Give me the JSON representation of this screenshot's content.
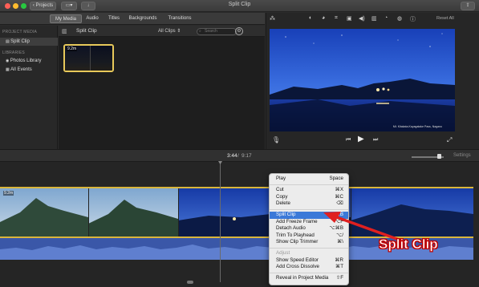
{
  "window": {
    "title": "Split Clip",
    "projects_label": "Projects"
  },
  "tabs": [
    {
      "label": "My Media"
    },
    {
      "label": "Audio"
    },
    {
      "label": "Titles"
    },
    {
      "label": "Backgrounds"
    },
    {
      "label": "Transitions"
    }
  ],
  "sidebar": {
    "project_media_header": "PROJECT MEDIA",
    "project_item": "Split Clip",
    "libraries_header": "LIBRARIES",
    "library_items": [
      "Photos Library",
      "All Events"
    ]
  },
  "browser": {
    "title": "Split Clip",
    "filter_value": "All Clips",
    "search_placeholder": "Search",
    "clip_duration": "9.2m"
  },
  "viewer": {
    "reset_all": "Reset All",
    "watermark": "Mt. Kitakata-Kayagatake Pass, Nagano"
  },
  "timeline": {
    "current_time": "3:44",
    "total_time": "9:17",
    "settings_label": "Settings",
    "clip_duration": "9.2m"
  },
  "context_menu": {
    "groups": [
      [
        {
          "label": "Play",
          "shortcut": "Space"
        }
      ],
      [
        {
          "label": "Cut",
          "shortcut": "⌘X"
        },
        {
          "label": "Copy",
          "shortcut": "⌘C"
        },
        {
          "label": "Delete",
          "shortcut": "⌫"
        }
      ],
      [
        {
          "label": "Split Clip",
          "shortcut": "⌘B",
          "highlighted": true
        },
        {
          "label": "Add Freeze Frame",
          "shortcut": "⌥F"
        },
        {
          "label": "Detach Audio",
          "shortcut": "⌥⌘B"
        },
        {
          "label": "Trim To Playhead",
          "shortcut": "⌥/"
        },
        {
          "label": "Show Clip Trimmer",
          "shortcut": "⌘\\"
        }
      ],
      [
        {
          "label": "Adjust",
          "shortcut": "",
          "disabled": true
        },
        {
          "label": "Show Speed Editor",
          "shortcut": "⌘R"
        },
        {
          "label": "Add Cross Dissolve",
          "shortcut": "⌘T"
        }
      ],
      [
        {
          "label": "Reveal in Project Media",
          "shortcut": "⇧F"
        }
      ]
    ]
  },
  "annotation": {
    "callout_text": "Split Clip"
  },
  "colors": {
    "accent_highlight": "#3b79d8",
    "clip_border": "#d9b63c",
    "audio_track": "#3a57a8",
    "callout": "#e02020"
  }
}
